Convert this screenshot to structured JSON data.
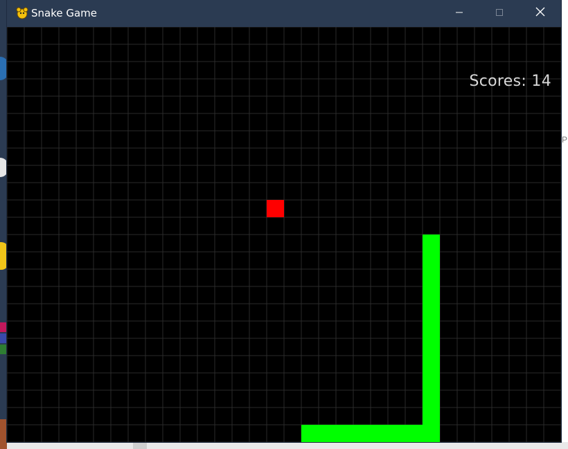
{
  "window": {
    "title": "Snake Game",
    "minimize_icon": "minimize-icon",
    "maximize_icon": "maximize-icon",
    "close_icon": "close-icon",
    "app_icon": "pygame-snake-icon"
  },
  "game": {
    "score_label": "Scores: 14",
    "background_color": "#000000",
    "grid_color": "#2a2a2a",
    "snake_color": "#00ff00",
    "food_color": "#ff0000",
    "grid": {
      "cols": 32,
      "rows": 24
    },
    "food": {
      "col": 15,
      "row": 10
    },
    "snake": [
      [
        24,
        12
      ],
      [
        24,
        13
      ],
      [
        24,
        14
      ],
      [
        24,
        15
      ],
      [
        24,
        16
      ],
      [
        24,
        17
      ],
      [
        24,
        18
      ],
      [
        24,
        19
      ],
      [
        24,
        20
      ],
      [
        24,
        21
      ],
      [
        24,
        22
      ],
      [
        24,
        23
      ],
      [
        23,
        23
      ],
      [
        22,
        23
      ],
      [
        21,
        23
      ],
      [
        20,
        23
      ],
      [
        19,
        23
      ],
      [
        18,
        23
      ],
      [
        17,
        23
      ]
    ]
  },
  "desktop": {
    "right_edge_text": "P"
  }
}
